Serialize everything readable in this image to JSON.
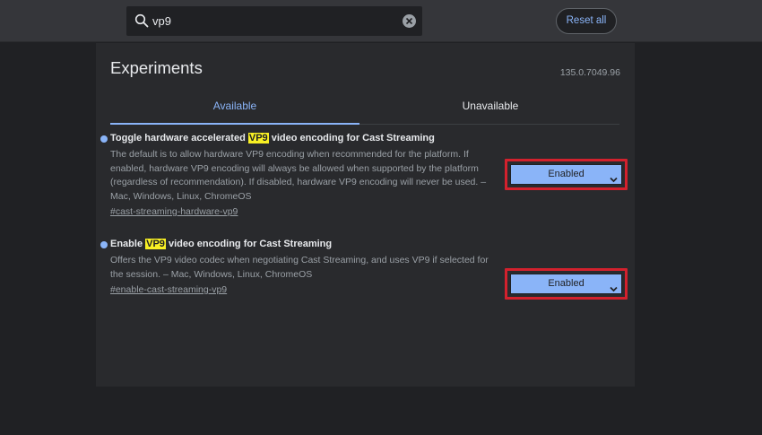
{
  "search": {
    "value": "vp9",
    "placeholder": "Search flags"
  },
  "header": {
    "reset_label": "Reset all"
  },
  "page": {
    "title": "Experiments",
    "version": "135.0.7049.96"
  },
  "tabs": [
    {
      "label": "Available",
      "active": true
    },
    {
      "label": "Unavailable",
      "active": false
    }
  ],
  "experiments": [
    {
      "title_before": "Toggle hardware accelerated ",
      "title_highlight": "VP9",
      "title_after": " video encoding for Cast Streaming",
      "description": "The default is to allow hardware VP9 encoding when recommended for the platform. If enabled, hardware VP9 encoding will always be allowed when supported by the platform (regardless of recommendation). If disabled, hardware VP9 encoding will never be used. – Mac, Windows, Linux, ChromeOS",
      "link": "#cast-streaming-hardware-vp9",
      "selected": "Enabled"
    },
    {
      "title_before": "Enable ",
      "title_highlight": "VP9",
      "title_after": " video encoding for Cast Streaming",
      "description": "Offers the VP9 video codec when negotiating Cast Streaming, and uses VP9 if selected for the session. – Mac, Windows, Linux, ChromeOS",
      "link": "#enable-cast-streaming-vp9",
      "selected": "Enabled"
    }
  ],
  "colors": {
    "accent": "#8ab4f8",
    "highlight": "#f8f024",
    "annotation_outline": "#d3212d",
    "background": "#202124",
    "panel": "#292a2d"
  },
  "icons": {
    "search": "search-icon",
    "clear": "clear-icon",
    "dropdown": "chevron-down-icon"
  }
}
